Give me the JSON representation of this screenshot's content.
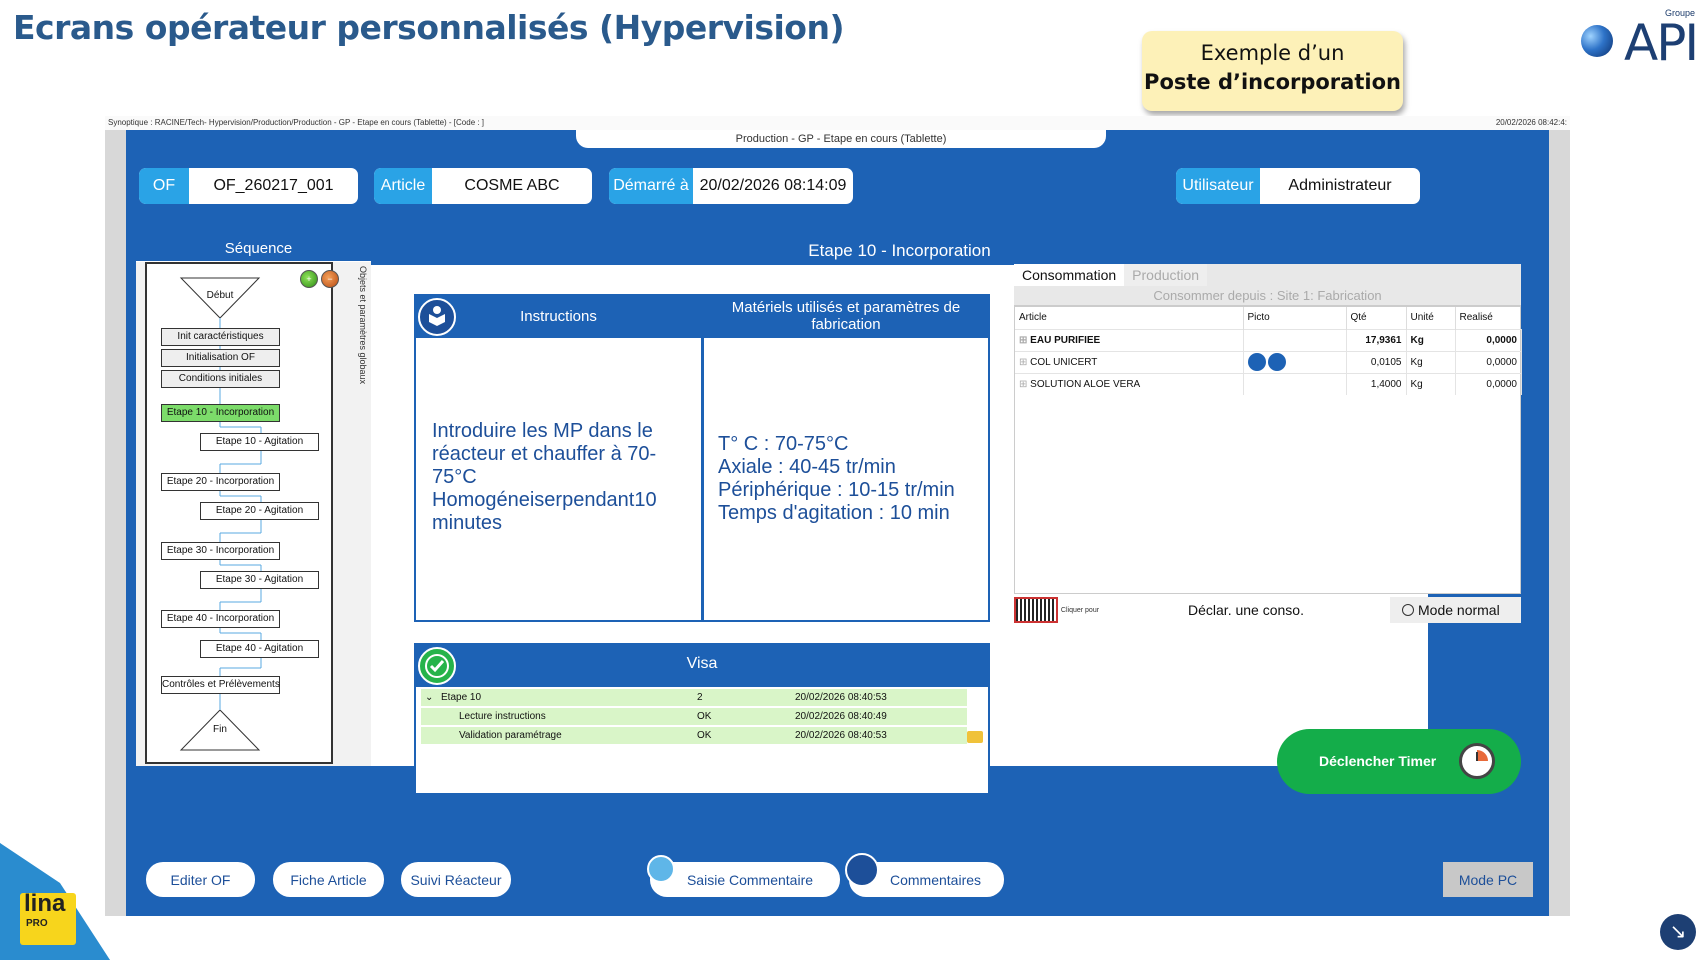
{
  "slide": {
    "title": "Ecrans opérateur personnalisés (Hypervision)",
    "callout_line1": "Exemple d’un",
    "callout_line2": "Poste d’incorporation",
    "logo_text": "API",
    "logo_group": "Groupe"
  },
  "app": {
    "synoptique": "Synoptique : RACINE/Tech- Hypervision/Production/Production - GP - Etape en cours (Tablette) - [Code : ]",
    "datetime": "20/02/2026 08:42:4:",
    "screen_title": "Production - GP - Etape en cours (Tablette)"
  },
  "header_fields": {
    "of_label": "OF",
    "of_value": "OF_260217_001",
    "article_label": "Article",
    "article_value": "COSME ABC",
    "start_label": "Démarré à",
    "start_value": "20/02/2026 08:14:09",
    "user_label": "Utilisateur",
    "user_value": "Administrateur"
  },
  "sequence": {
    "title": "Séquence",
    "side_label": "Objets et paramètres globaux",
    "start": "Début",
    "end": "Fin",
    "steps": [
      "Init caractéristiques",
      "Initialisation OF",
      "Conditions initiales",
      "Etape 10 - Incorporation",
      "Etape 10 - Agitation",
      "Etape 20 - Incorporation",
      "Etape 20 - Agitation",
      "Etape 30 - Incorporation",
      "Etape 30 - Agitation",
      "Etape 40 - Incorporation",
      "Etape 40 - Agitation",
      "Contrôles et Prélèvements"
    ]
  },
  "step": {
    "title": "Etape 10 - Incorporation",
    "instructions_title": "Instructions",
    "instructions_text": "Introduire les MP dans le réacteur et chauffer à 70-75°C Homogéneiserpendant10 minutes",
    "materials_title": "Matériels utilisés et paramètres de fabrication",
    "materials_lines": [
      "T° C : 70-75°C",
      "Axiale : 40-45 tr/min",
      "Périphérique : 10-15 tr/min",
      "Temps d'agitation : 10 min"
    ]
  },
  "consumption": {
    "tab_conso": "Consommation",
    "tab_prod": "Production",
    "source": "Consommer depuis : Site 1: Fabrication",
    "columns": [
      "Article",
      "Picto",
      "Qté",
      "Unité",
      "Realisé"
    ],
    "rows": [
      {
        "article": "EAU PURIFIEE",
        "qty": "17,9361",
        "unit": "Kg",
        "done": "0,0000",
        "bold": true
      },
      {
        "article": "COL UNICERT",
        "qty": "0,0105",
        "unit": "Kg",
        "done": "0,0000",
        "bold": false
      },
      {
        "article": "SOLUTION ALOE VERA",
        "qty": "1,4000",
        "unit": "Kg",
        "done": "0,0000",
        "bold": false
      }
    ],
    "click_hint": "Cliquer pour",
    "declare": "Déclar. une conso.",
    "mode": "Mode normal"
  },
  "visa": {
    "title": "Visa",
    "rows": [
      {
        "name": "Etape 10",
        "status": "2",
        "date": "20/02/2026 08:40:53"
      },
      {
        "name": "Lecture instructions",
        "status": "OK",
        "date": "20/02/2026 08:40:49"
      },
      {
        "name": "Validation paramétrage",
        "status": "OK",
        "date": "20/02/2026 08:40:53"
      }
    ]
  },
  "timer_label": "Déclencher Timer",
  "buttons": {
    "edit_of": "Editer OF",
    "fiche_article": "Fiche Article",
    "suivi_reacteur": "Suivi Réacteur",
    "saisie_commentaire": "Saisie Commentaire",
    "commentaires": "Commentaires",
    "mode_pc": "Mode PC"
  },
  "lina": {
    "name": "lina",
    "edition": "PRO"
  },
  "colors": {
    "title": "#2a5a8c",
    "panel_blue": "#1d62b5",
    "label_blue": "#2aa3e6",
    "active_step": "#7cdc6a",
    "timer_green": "#14ad4a"
  }
}
